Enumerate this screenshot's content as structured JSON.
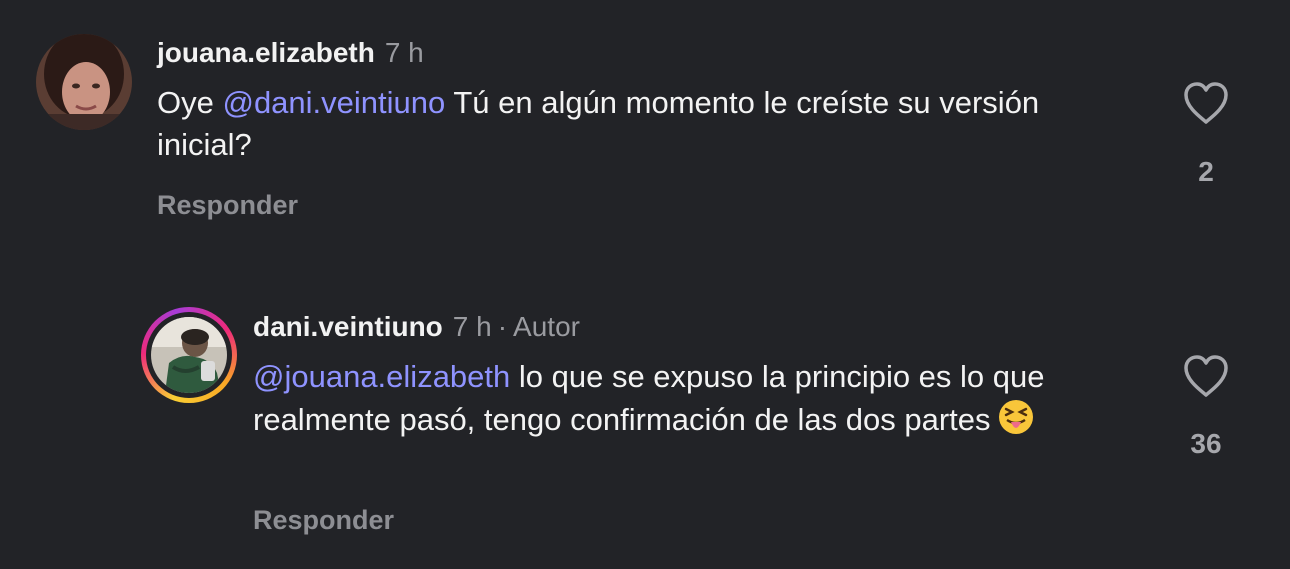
{
  "comments": [
    {
      "username": "jouana.elizabeth",
      "time": "7 h",
      "text_prefix": "Oye ",
      "mention": "@dani.veintiuno",
      "text_suffix": " Tú en algún momento le creíste su versión inicial?",
      "reply_label": "Responder",
      "like_count": "2",
      "avatar_icon": "avatar-photo-woman",
      "heart_icon": "heart-outline-icon"
    },
    {
      "username": "dani.veintiuno",
      "time": "7 h",
      "separator": "·",
      "author_badge": "Autor",
      "mention": "@jouana.elizabeth",
      "text_suffix": " lo que se expuso la principio es lo que realmente pasó, tengo confirmación de las dos partes",
      "emoji": "😝",
      "reply_label": "Responder",
      "like_count": "36",
      "avatar_icon": "avatar-photo-man-story-ring",
      "heart_icon": "heart-outline-icon"
    }
  ],
  "colors": {
    "background": "#222327",
    "mention": "#8f93ff",
    "muted": "#9a9ba0"
  }
}
